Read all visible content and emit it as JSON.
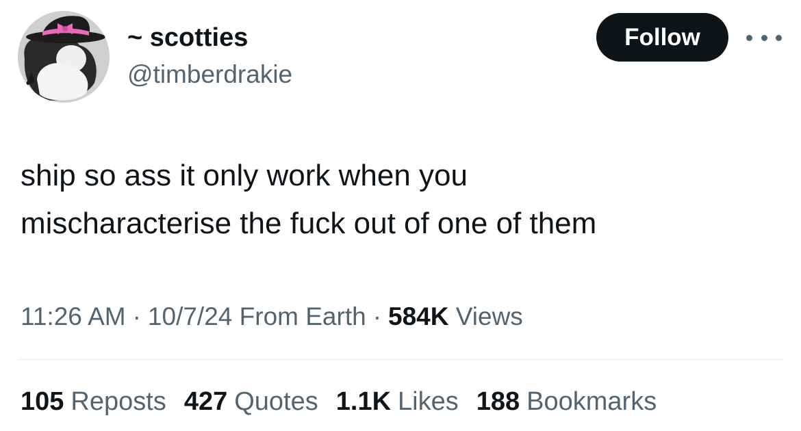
{
  "author": {
    "display_name": "~ scotties",
    "handle": "@timberdrakie",
    "avatar_icon": "witch-hat-avatar"
  },
  "actions": {
    "follow_label": "Follow",
    "more_icon": "more-dots-icon"
  },
  "tweet": {
    "text_lines": [
      "ship so ass it only work when you",
      "mischaracterise the fuck out of one of them"
    ]
  },
  "meta": {
    "time": "11:26 AM",
    "date": "10/7/24",
    "source": "From Earth",
    "views_count": "584K",
    "views_label": "Views",
    "separator": "·"
  },
  "stats": {
    "reposts": {
      "count": "105",
      "label": "Reposts"
    },
    "quotes": {
      "count": "427",
      "label": "Quotes"
    },
    "likes": {
      "count": "1.1K",
      "label": "Likes"
    },
    "bookmarks": {
      "count": "188",
      "label": "Bookmarks"
    }
  },
  "colors": {
    "text_primary": "#0f1419",
    "text_secondary": "#536471",
    "button_bg": "#0f1419",
    "button_text": "#ffffff",
    "divider": "#e6e8ea",
    "avatar_ribbon": "#e86ab8"
  }
}
